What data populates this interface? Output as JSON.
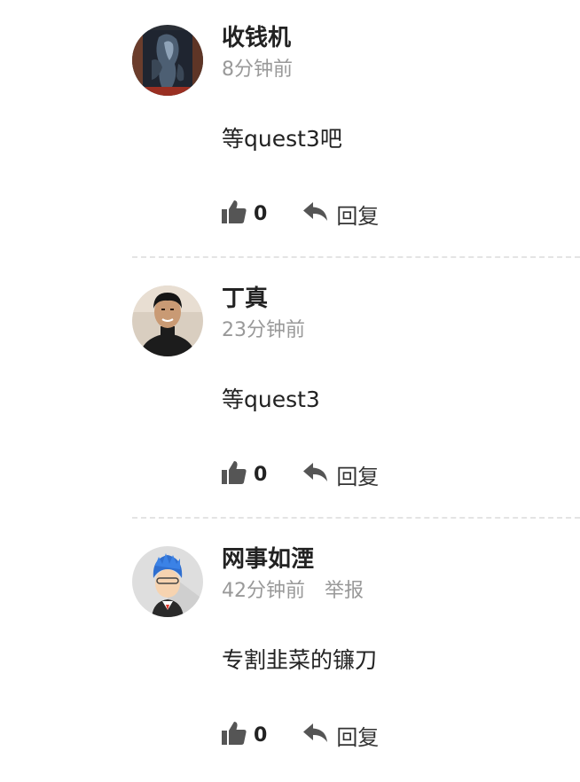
{
  "comments": [
    {
      "username": "收钱机",
      "time": "8分钟前",
      "report": "",
      "text": "等quest3吧",
      "likes": "0",
      "reply_label": "回复",
      "avatar": "dark-artwork"
    },
    {
      "username": "丁真",
      "time": "23分钟前",
      "report": "",
      "text": "等quest3",
      "likes": "0",
      "reply_label": "回复",
      "avatar": "person-photo"
    },
    {
      "username": "网事如湮",
      "time": "42分钟前",
      "report": "举报",
      "text": "专割韭菜的镰刀",
      "likes": "0",
      "reply_label": "回复",
      "avatar": "cartoon-blue-hair"
    }
  ],
  "icons": {
    "like": "thumbs-up-icon",
    "reply": "reply-arrow-icon"
  },
  "colors": {
    "username": "#222222",
    "meta": "#999999",
    "action_icon": "#555555",
    "divider": "#e4e4e4"
  }
}
